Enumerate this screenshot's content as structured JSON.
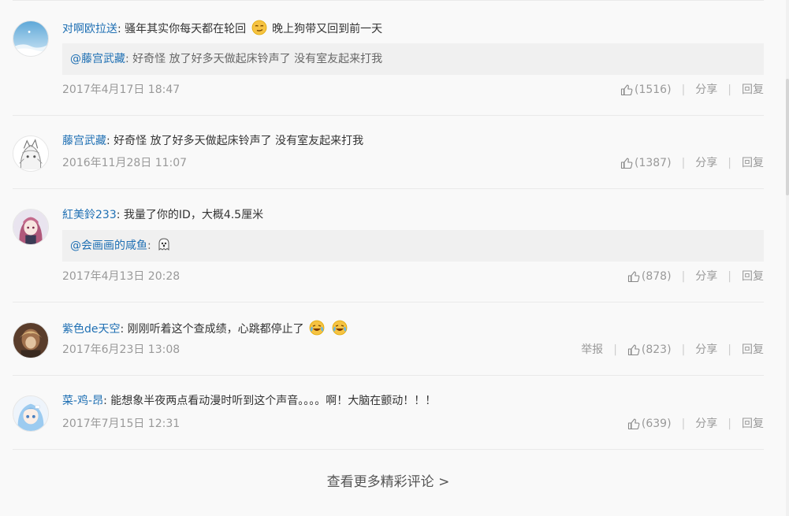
{
  "comments": [
    {
      "user": "对啊欧拉送",
      "text_before": "骚年其实你每天都在轮回",
      "text_after": "晚上狗带又回到前一天",
      "quote_user": "@藤宫武藏",
      "quote_text": "好奇怪 放了好多天做起床铃声了 没有室友起来打我",
      "date": "2017年4月17日 18:47",
      "likes": "(1516)",
      "share": "分享",
      "reply": "回复"
    },
    {
      "user": "藤宫武藏",
      "text": "好奇怪 放了好多天做起床铃声了 没有室友起来打我",
      "date": "2016年11月28日 11:07",
      "likes": "(1387)",
      "share": "分享",
      "reply": "回复"
    },
    {
      "user": "紅美鈴233",
      "text": "我量了你的ID，大概4.5厘米",
      "quote_user": "@会画画的咸鱼",
      "date": "2017年4月13日 20:28",
      "likes": "(878)",
      "share": "分享",
      "reply": "回复"
    },
    {
      "user": "紫色de天空",
      "text": "刚刚听着这个查成绩，心跳都停止了",
      "date": "2017年6月23日 13:08",
      "report": "举报",
      "likes": "(823)",
      "share": "分享",
      "reply": "回复"
    },
    {
      "user": "菜-鸡-昂",
      "text": "能想象半夜两点看动漫时听到这个声音。。。。啊！大脑在颤动！！！",
      "date": "2017年7月15日 12:31",
      "likes": "(639)",
      "share": "分享",
      "reply": "回复"
    }
  ],
  "colon": ":",
  "more_label": "查看更多精彩评论 >",
  "colors": {
    "username": "#1e6fb3",
    "meta": "#999999",
    "quote_bg": "#f0f0f0",
    "divider": "#eaeaea"
  },
  "icons": [
    "thumbs-up-icon",
    "smirk-emoji-icon",
    "ghost-emoji-icon",
    "laugh-cry-emoji-icon"
  ]
}
